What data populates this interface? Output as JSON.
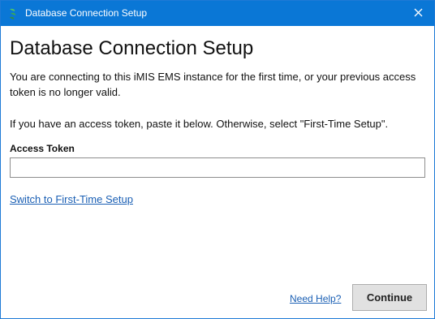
{
  "window": {
    "title": "Database Connection Setup",
    "icon": "app-leaf-icon",
    "close_icon": "close-icon",
    "accent_color": "#0a77d6"
  },
  "main": {
    "heading": "Database Connection Setup",
    "description": "You are connecting to this iMIS EMS instance for the first time, or your previous access token is no longer valid.",
    "instruction": "If you have an access token, paste it below. Otherwise, select \"First-Time Setup\".",
    "token_label": "Access Token",
    "token_value": "",
    "switch_link": "Switch to First-Time Setup"
  },
  "footer": {
    "help_link": "Need Help?",
    "continue_label": "Continue"
  }
}
